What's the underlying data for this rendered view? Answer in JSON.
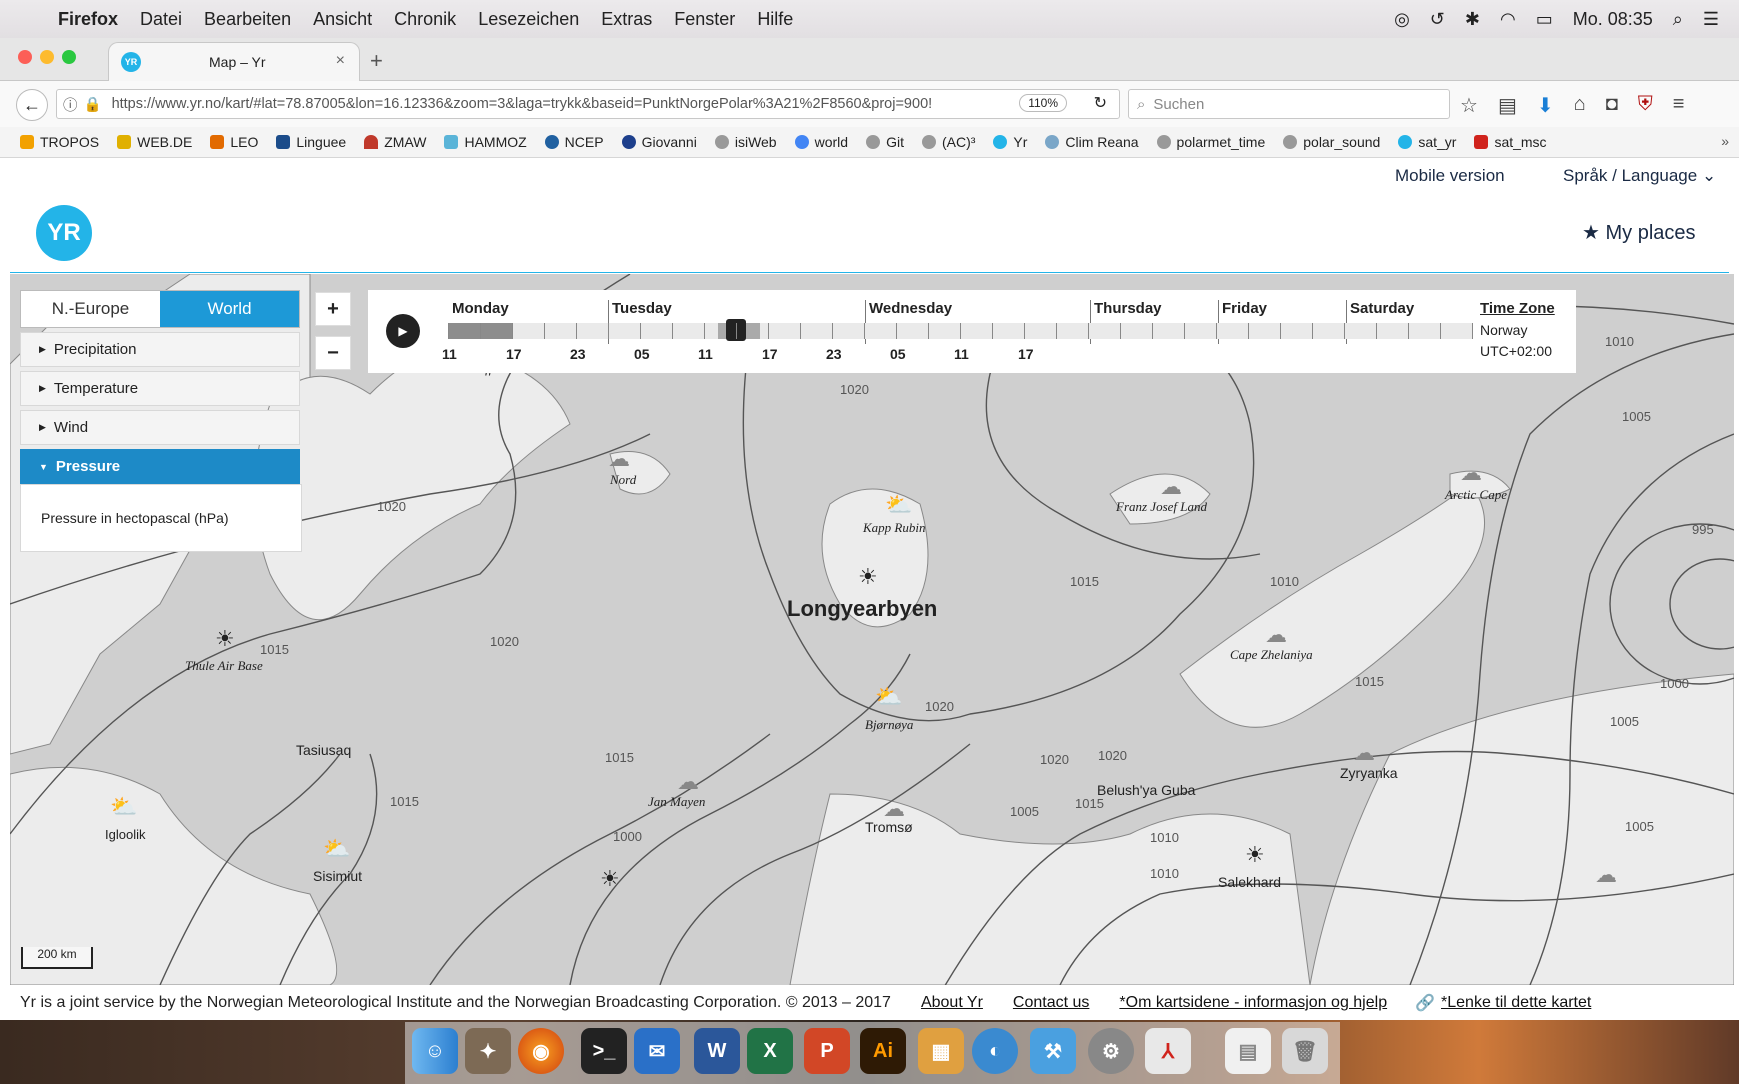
{
  "menubar": {
    "app": "Firefox",
    "items": [
      "Datei",
      "Bearbeiten",
      "Ansicht",
      "Chronik",
      "Lesezeichen",
      "Extras",
      "Fenster",
      "Hilfe"
    ],
    "clock": "Mo. 08:35"
  },
  "tab": {
    "title": "Map – Yr",
    "favicon": "yr"
  },
  "nav": {
    "url": "https://www.yr.no/kart/#lat=78.87005&lon=16.12336&zoom=3&laga=trykk&baseid=PunktNorgePolar%3A21%2F8560&proj=900!",
    "zoom": "110%",
    "search_placeholder": "Suchen"
  },
  "bookmarks": [
    "TROPOS",
    "WEB.DE",
    "LEO",
    "Linguee",
    "ZMAW",
    "HAMMOZ",
    "NCEP",
    "Giovanni",
    "isiWeb",
    "world",
    "Git",
    "(AC)³",
    "Yr",
    "Clim Reana",
    "polarmet_time",
    "polar_sound",
    "sat_yr",
    "sat_msc"
  ],
  "header": {
    "mobile": "Mobile version",
    "language": "Språk / Language",
    "logo": "YR",
    "my_places": "My places"
  },
  "layers": {
    "region_tabs": [
      "N.-Europe",
      "World"
    ],
    "active_region": "World",
    "items": [
      "Precipitation",
      "Temperature",
      "Wind",
      "Pressure"
    ],
    "active": "Pressure",
    "description": "Pressure in hectopascal (hPa)"
  },
  "timeline": {
    "days": [
      "Monday",
      "Tuesday",
      "Wednesday",
      "Thursday",
      "Friday",
      "Saturday"
    ],
    "hours": [
      "11",
      "17",
      "23",
      "05",
      "11",
      "17",
      "23",
      "05",
      "11",
      "17"
    ],
    "timezone_title": "Time Zone",
    "timezone_name": "Norway",
    "timezone_offset": "UTC+02:00"
  },
  "map": {
    "places": [
      "Coffee Club Island",
      "Nord",
      "Kapp Rubin",
      "Franz Josef Land",
      "Arctic Cape",
      "Longyearbyen",
      "Thule Air Base",
      "Cape Zhelaniya",
      "Bjørnøya",
      "Tasiusaq",
      "Jan Mayen",
      "Tromsø",
      "Belush'ya Guba",
      "Zyryanka",
      "Igloolik",
      "Sisimiut",
      "Salekhard"
    ],
    "isobars": [
      "1020",
      "1015",
      "1010",
      "1005",
      "1000",
      "995"
    ],
    "scale": "200 km"
  },
  "footer": {
    "copyright": "Yr is a joint service by the Norwegian Meteorological Institute and the Norwegian Broadcasting Corporation. © 2013 – 2017",
    "about": "About Yr",
    "contact": "Contact us",
    "info": "*Om kartsidene - informasjon og hjelp",
    "link": "*Lenke til dette kartet"
  },
  "colors": {
    "accent": "#1d99d7",
    "yr_blue": "#23b4e8"
  }
}
